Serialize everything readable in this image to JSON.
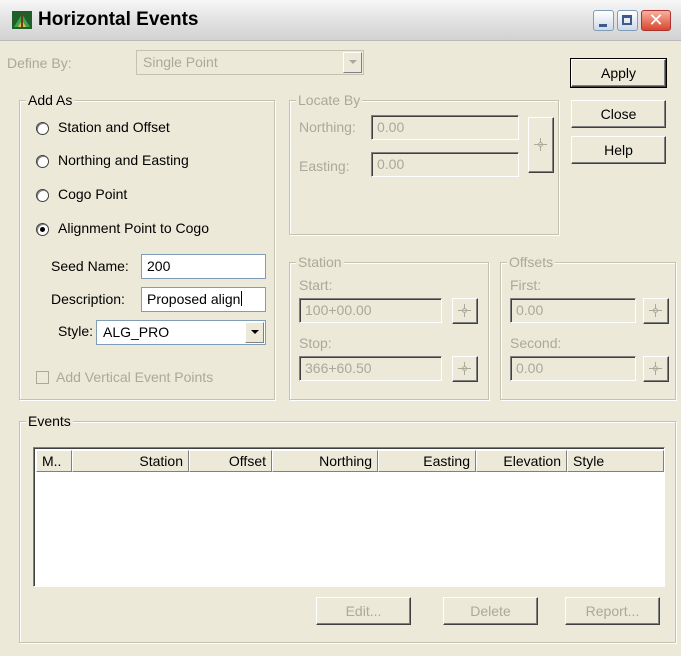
{
  "window": {
    "title": "Horizontal Events"
  },
  "define_by": {
    "label": "Define By:",
    "value": "Single Point"
  },
  "buttons": {
    "apply": "Apply",
    "close": "Close",
    "help": "Help"
  },
  "add_as": {
    "title": "Add As",
    "options": [
      {
        "label": "Station and Offset",
        "checked": false
      },
      {
        "label": "Northing and Easting",
        "checked": false
      },
      {
        "label": "Cogo Point",
        "checked": false
      },
      {
        "label": "Alignment Point to Cogo",
        "checked": true
      }
    ],
    "seed_name_label": "Seed Name:",
    "seed_name_value": "200",
    "description_label": "Description:",
    "description_value": "Proposed align",
    "style_label": "Style:",
    "style_value": "ALG_PRO",
    "add_vertical_label": "Add Vertical Event Points"
  },
  "locate_by": {
    "title": "Locate By",
    "northing_label": "Northing:",
    "northing_value": "0.00",
    "easting_label": "Easting:",
    "easting_value": "0.00"
  },
  "station": {
    "title": "Station",
    "start_label": "Start:",
    "start_value": "100+00.00",
    "stop_label": "Stop:",
    "stop_value": "366+60.50"
  },
  "offsets": {
    "title": "Offsets",
    "first_label": "First:",
    "first_value": "0.00",
    "second_label": "Second:",
    "second_value": "0.00"
  },
  "events": {
    "title": "Events",
    "columns": [
      "M..",
      "Station",
      "Offset",
      "Northing",
      "Easting",
      "Elevation",
      "Style"
    ],
    "rows": [],
    "edit_label": "Edit...",
    "delete_label": "Delete",
    "report_label": "Report..."
  }
}
